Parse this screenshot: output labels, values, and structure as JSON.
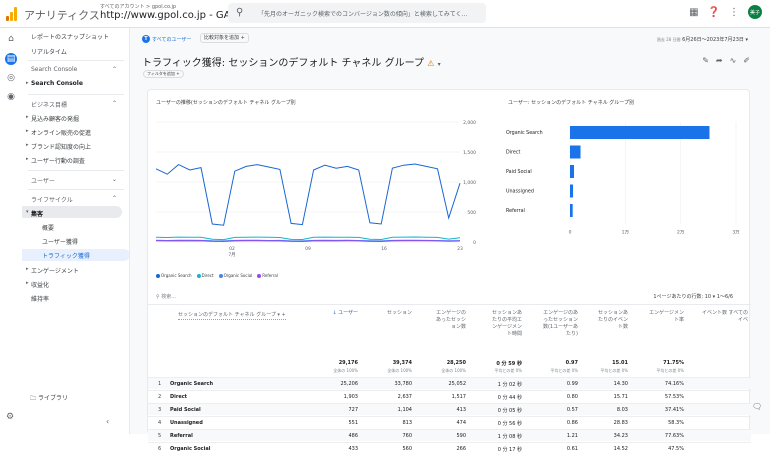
{
  "header": {
    "app_name": "アナリティクス",
    "account_crumb": "すべてのアカウント > gpol.co.jp",
    "property": "http://www.gpol.co.jp - GA4 ▾",
    "search_placeholder": "「先月のオーガニック検索でのコンバージョン数の傾向」と検索してみてく...",
    "avatar": "美子"
  },
  "sidebar": {
    "snapshot": "レポートのスナップショット",
    "realtime": "リアルタイム",
    "search_console_header": "Search Console",
    "search_console_item": "Search Console",
    "business_goals": "ビジネス目標",
    "items1": [
      "見込み顧客の発掘",
      "オンライン販売の促進",
      "ブランド認知度の向上",
      "ユーザー行動の調査"
    ],
    "user_header": "ユーザー",
    "lifecycle_header": "ライフサイクル",
    "acquisition": "集客",
    "acq_items": [
      "概要",
      "ユーザー獲得",
      "トラフィック獲得"
    ],
    "engagement": "エンゲージメント",
    "monetization": "収益化",
    "retention": "維持率",
    "library": "ライブラリ"
  },
  "toolbar": {
    "all_users": "すべてのユーザー",
    "compare": "比較対象を追加 +",
    "date_small": "過去 28 日間",
    "date_range": "6月26日～2023年7月23日 ▾"
  },
  "page": {
    "title": "トラフィック獲得: セッションのデフォルト チャネル グループ",
    "warn": "⚠",
    "add_filter": "フィルタを追加 +"
  },
  "line_chart": {
    "title": "ユーザーの推移(セッションのデフォルト チャネル グループ別",
    "y_ticks": [
      "2,000",
      "1,500",
      "1,000",
      "500",
      "0"
    ],
    "x_ticks": [
      "02",
      "09",
      "16",
      "23"
    ],
    "x_sub": "7月",
    "legend": [
      "Organic Search",
      "Direct",
      "Organic Social",
      "Referral"
    ]
  },
  "bar_chart": {
    "title": "ユーザー: セッションのデフォルト チャネル グループ別",
    "categories": [
      "Organic Search",
      "Direct",
      "Paid Social",
      "Unassigned",
      "Referral"
    ],
    "x_ticks": [
      "0",
      "1万",
      "2万",
      "3万"
    ]
  },
  "chart_data": [
    {
      "type": "line",
      "title": "ユーザーの推移(セッションのデフォルト チャネル グループ別",
      "x_ticks": [
        "02",
        "09",
        "16",
        "23"
      ],
      "ylim": [
        0,
        2000
      ],
      "series": [
        {
          "name": "Organic Search",
          "color": "#1967d2",
          "values": [
            1220,
            1130,
            1290,
            1200,
            1240,
            300,
            280,
            1180,
            1260,
            1290,
            1250,
            1210,
            310,
            290,
            1200,
            1280,
            1230,
            1260,
            1200,
            320,
            300,
            1230,
            1280,
            1300,
            1260,
            1220,
            400,
            980
          ]
        },
        {
          "name": "Direct",
          "color": "#12b5cb",
          "values": [
            80,
            75,
            82,
            78,
            80,
            45,
            40,
            76,
            80,
            82,
            79,
            75,
            44,
            42,
            78,
            81,
            79,
            80,
            76,
            45,
            42,
            78,
            82,
            84,
            80,
            76,
            48,
            70
          ]
        },
        {
          "name": "Organic Social",
          "color": "#4285f4",
          "values": [
            30,
            25,
            28,
            30,
            26,
            20,
            18,
            27,
            30,
            28,
            25,
            27,
            19,
            18,
            26,
            28,
            27,
            29,
            25,
            20,
            18,
            26,
            28,
            30,
            27,
            25,
            20,
            24
          ]
        },
        {
          "name": "Referral",
          "color": "#a142f4",
          "values": [
            20,
            18,
            22,
            19,
            20,
            10,
            9,
            19,
            21,
            22,
            19,
            18,
            10,
            9,
            18,
            21,
            19,
            20,
            18,
            10,
            9,
            19,
            21,
            22,
            20,
            18,
            11,
            17
          ]
        }
      ]
    },
    {
      "type": "bar",
      "title": "ユーザー: セッションのデフォルト チャネル グループ別",
      "categories": [
        "Organic Search",
        "Direct",
        "Paid Social",
        "Unassigned",
        "Referral"
      ],
      "values": [
        25206,
        1903,
        727,
        551,
        486
      ],
      "xlim": [
        0,
        30000
      ]
    }
  ],
  "table": {
    "search_placeholder": "検索...",
    "rows_per_page": "1ページあたりの行数: 10 ▾     1～6/6",
    "dim_header": "セッションのデフォルト チャネル グループ ▾ +",
    "headers": [
      "↓ ユーザー",
      "セッション",
      "エンゲージのあったセッション数",
      "セッションあたりの平均エンゲージメント時間",
      "エンゲージのあったセッション数(1ユーザーあたり)",
      "セッションあたりのイベント数",
      "エンゲージメント率",
      "イベント数 すべてのイベ"
    ],
    "totals": [
      "29,176",
      "39,374",
      "28,250",
      "0 分 59 秒",
      "0.97",
      "15.01",
      "71.75%"
    ],
    "totals_sub": [
      "全体の 100%",
      "全体の 100%",
      "全体の 100%",
      "平均との差 0%",
      "平均との差 0%",
      "平均との差 0%",
      "平均との差 0%"
    ],
    "rows": [
      {
        "i": "1",
        "ch": "Organic Search",
        "v": [
          "25,206",
          "33,780",
          "25,052",
          "1 分 02 秒",
          "0.99",
          "14.30",
          "74.16%"
        ]
      },
      {
        "i": "2",
        "ch": "Direct",
        "v": [
          "1,903",
          "2,637",
          "1,517",
          "0 分 44 秒",
          "0.80",
          "15.71",
          "57.53%"
        ]
      },
      {
        "i": "3",
        "ch": "Paid Social",
        "v": [
          "727",
          "1,104",
          "413",
          "0 分 05 秒",
          "0.57",
          "8.03",
          "37.41%"
        ]
      },
      {
        "i": "4",
        "ch": "Unassigned",
        "v": [
          "551",
          "813",
          "474",
          "0 分 56 秒",
          "0.86",
          "28.83",
          "58.3%"
        ]
      },
      {
        "i": "5",
        "ch": "Referral",
        "v": [
          "486",
          "760",
          "590",
          "1 分 08 秒",
          "1.21",
          "34.23",
          "77.63%"
        ]
      },
      {
        "i": "6",
        "ch": "Organic Social",
        "v": [
          "433",
          "560",
          "266",
          "0 分 17 秒",
          "0.61",
          "14.52",
          "47.5%"
        ]
      }
    ]
  }
}
